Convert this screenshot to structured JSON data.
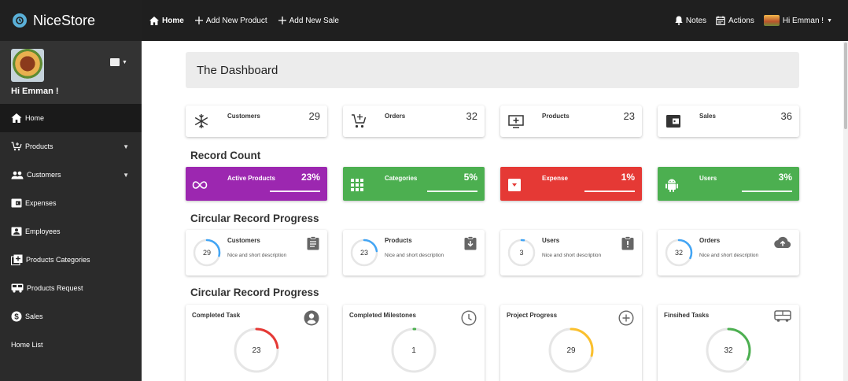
{
  "app": {
    "name": "NiceStore"
  },
  "topnav": {
    "home": "Home",
    "add_product": "Add New Product",
    "add_sale": "Add New Sale",
    "notes": "Notes",
    "actions": "Actions",
    "user": "Hi Emman !"
  },
  "sidebar": {
    "username": "Hi Emman !",
    "items": [
      {
        "label": "Home"
      },
      {
        "label": "Products"
      },
      {
        "label": "Customers"
      },
      {
        "label": "Expenses"
      },
      {
        "label": "Employees"
      },
      {
        "label": "Products Categories"
      },
      {
        "label": "Products Request"
      },
      {
        "label": "Sales"
      },
      {
        "label": "Home List"
      }
    ]
  },
  "dashboard": {
    "title": "The Dashboard",
    "stats": [
      {
        "label": "Customers",
        "value": "29",
        "icon": "snowflake-icon"
      },
      {
        "label": "Orders",
        "value": "32",
        "icon": "cart-icon"
      },
      {
        "label": "Products",
        "value": "23",
        "icon": "monitor-plus-icon"
      },
      {
        "label": "Sales",
        "value": "36",
        "icon": "wallet-icon"
      }
    ],
    "record_count_title": "Record Count",
    "record_counts": [
      {
        "label": "Active Products",
        "value": "23%",
        "fraction": 0.23,
        "color": "#9c27b0",
        "icon": "infinity-icon"
      },
      {
        "label": "Categories",
        "value": "5%",
        "fraction": 0.05,
        "color": "#4caf50",
        "icon": "grid-icon"
      },
      {
        "label": "Expense",
        "value": "1%",
        "fraction": 0.01,
        "color": "#e53935",
        "icon": "inbox-icon"
      },
      {
        "label": "Users",
        "value": "3%",
        "fraction": 0.03,
        "color": "#4caf50",
        "icon": "android-icon"
      }
    ],
    "circular_title_1": "Circular Record Progress",
    "circular_records": [
      {
        "label": "Customers",
        "value": "29",
        "desc": "Nice and short description",
        "progress": 0.29,
        "color": "#42a5f5",
        "icon": "clipboard-icon"
      },
      {
        "label": "Products",
        "value": "23",
        "desc": "Nice and short description",
        "progress": 0.23,
        "color": "#42a5f5",
        "icon": "clipboard-down-icon"
      },
      {
        "label": "Users",
        "value": "3",
        "desc": "Nice and short description",
        "progress": 0.03,
        "color": "#42a5f5",
        "icon": "clipboard-alert-icon"
      },
      {
        "label": "Orders",
        "value": "32",
        "desc": "Nice and short description",
        "progress": 0.32,
        "color": "#42a5f5",
        "icon": "cloud-upload-icon"
      }
    ],
    "circular_title_2": "Circular Record Progress",
    "progress_cards": [
      {
        "label": "Completed Task",
        "value": "23",
        "progress": 0.23,
        "color": "#e53935",
        "icon": "account-circle-icon"
      },
      {
        "label": "Completed Milestones",
        "value": "1",
        "progress": 0.01,
        "color": "#4caf50",
        "icon": "clock-icon"
      },
      {
        "label": "Project Progress",
        "value": "29",
        "progress": 0.29,
        "color": "#fbc02d",
        "icon": "plus-circle-icon"
      },
      {
        "label": "Finsihed Tasks",
        "value": "32",
        "progress": 0.32,
        "color": "#4caf50",
        "icon": "bus-icon"
      }
    ]
  }
}
